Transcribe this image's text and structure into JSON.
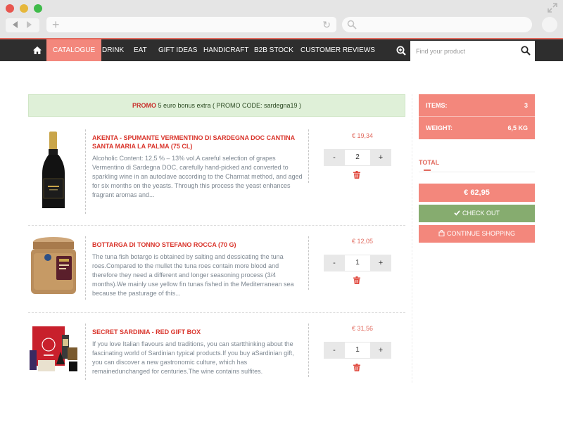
{
  "browser": {
    "url_placeholder": "",
    "search_placeholder": ""
  },
  "nav": {
    "items": [
      {
        "label": "CATALOGUE",
        "active": true
      },
      {
        "label": "DRINK"
      },
      {
        "label": "EAT"
      },
      {
        "label": "GIFT IDEAS"
      },
      {
        "label": "HANDICRAFT"
      },
      {
        "label": "B2B STOCK"
      },
      {
        "label": "CUSTOMER REVIEWS"
      }
    ],
    "search_placeholder": "Find your product"
  },
  "promo": {
    "label": "PROMO",
    "text": " 5 euro bonus extra ( PROMO CODE: sardegna19 )"
  },
  "products": [
    {
      "title": "AKENTA - SPUMANTE VERMENTINO DI SARDEGNA DOC CANTINA SANTA MARIA LA PALMA (75 CL)",
      "description": "Alcoholic Content: 12,5 % – 13% vol.A careful selection of grapes Vermentino di Sardegna DOC, carefully hand-picked and converted to sparkling wine in an autoclave according to the Charmat method, and aged for six months on the yeasts. Through this process the yeast enhances fragrant aromas and...",
      "price": "€ 19,34",
      "quantity": "2",
      "minus": "-",
      "plus": "+"
    },
    {
      "title": "BOTTARGA DI TONNO STEFANO ROCCA (70 G)",
      "description": "The tuna fish botargo is obtained by salting and dessicating the tuna roes.Compared to the mullet the tuna roes contain more blood and therefore they need a different and longer seasoning process (3/4 months).We mainly use yellow fin tunas fished in the Mediterranean sea because the pasturage of this...",
      "price": "€ 12,05",
      "quantity": "1",
      "minus": "-",
      "plus": "+"
    },
    {
      "title": "SECRET SARDINIA - RED GIFT BOX",
      "description": "If you love Italian flavours and traditions, you can startthinking about the fascinating world of Sardinian typical products.If you buy aSardinian gift, you can discover a new gastronomic culture, which has remainedunchanged for centuries.The wine contains sulfites.",
      "price": "€ 31,56",
      "quantity": "1",
      "minus": "-",
      "plus": "+"
    }
  ],
  "cart": {
    "items_label": "ITEMS:",
    "items_value": "3",
    "weight_label": "WEIGHT:",
    "weight_value": "6,5 KG",
    "total_label": "TOTAL",
    "total_value": "€ 62,95",
    "checkout_label": "CHECK OUT",
    "continue_label": "CONTINUE SHOPPING"
  },
  "colors": {
    "accent": "#f3877c",
    "nav_bg": "#2e2e2e",
    "promo_bg": "#dff0d8",
    "checkout": "#86ac6f",
    "title_red": "#d9342b"
  },
  "icons": {
    "home": "home-icon",
    "zoom": "zoom-in-icon",
    "search": "search-icon",
    "trash": "trash-icon",
    "check": "check-icon",
    "bag": "shopping-bag-icon"
  }
}
